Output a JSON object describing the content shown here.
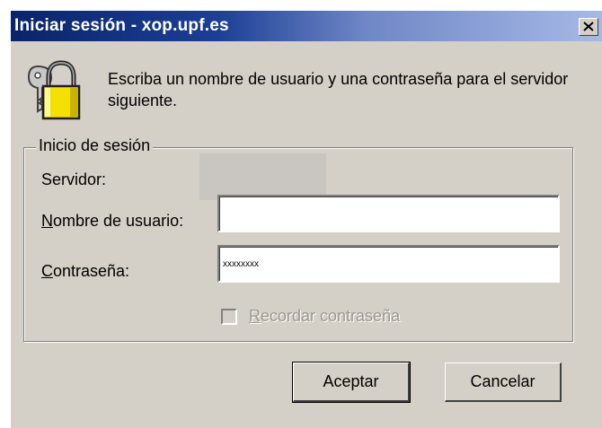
{
  "window": {
    "title": "Iniciar sesión - xop.upf.es",
    "close_label": "×"
  },
  "message": "Escriba un nombre de usuario y una contraseña para el servidor siguiente.",
  "group": {
    "legend": "Inicio de sesión",
    "server_label": "Servidor:",
    "server_value": "",
    "username_label_mnemonic": "N",
    "username_label_rest": "ombre de usuario:",
    "username_value": "",
    "password_label_mnemonic": "C",
    "password_label_rest": "ontraseña:",
    "password_value": "xxxxxxxx",
    "remember_mnemonic": "R",
    "remember_rest": "ecordar contraseña",
    "remember_checked": false,
    "remember_enabled": false
  },
  "buttons": {
    "ok": "Aceptar",
    "cancel": "Cancelar"
  },
  "colors": {
    "titlebar_start": "#0a246a",
    "titlebar_end": "#a6b9e6",
    "face": "#d4d0c8",
    "lock": "#f4e000"
  },
  "icons": [
    "lock-icon",
    "close-icon"
  ]
}
